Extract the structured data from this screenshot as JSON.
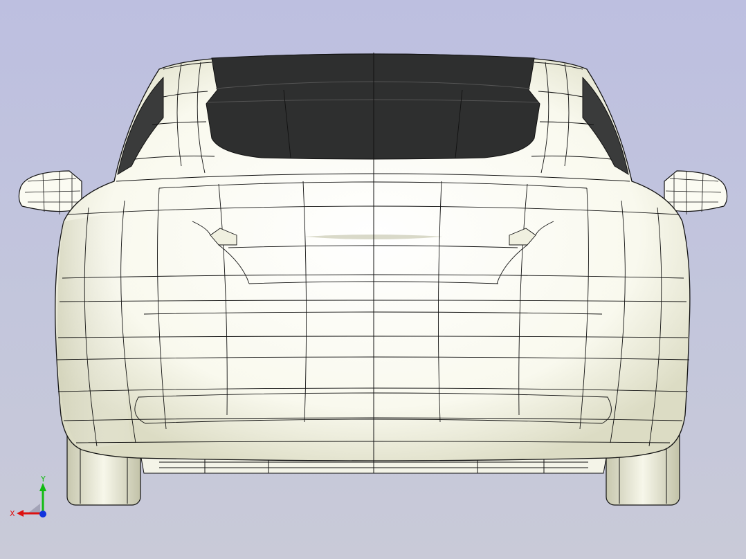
{
  "viewport": {
    "background_top": "#bdbfe0",
    "background_bottom": "#c9cad8"
  },
  "model": {
    "subject": "car-rear-view-wireframe",
    "body_color": "#fbfbf2",
    "glass_color": "#2e2f2f",
    "edge_color": "#111111"
  },
  "triad": {
    "x_label": "X",
    "y_label": "Y",
    "x_color": "#dd1111",
    "y_color": "#11bb11",
    "z_color": "#1133dd"
  }
}
